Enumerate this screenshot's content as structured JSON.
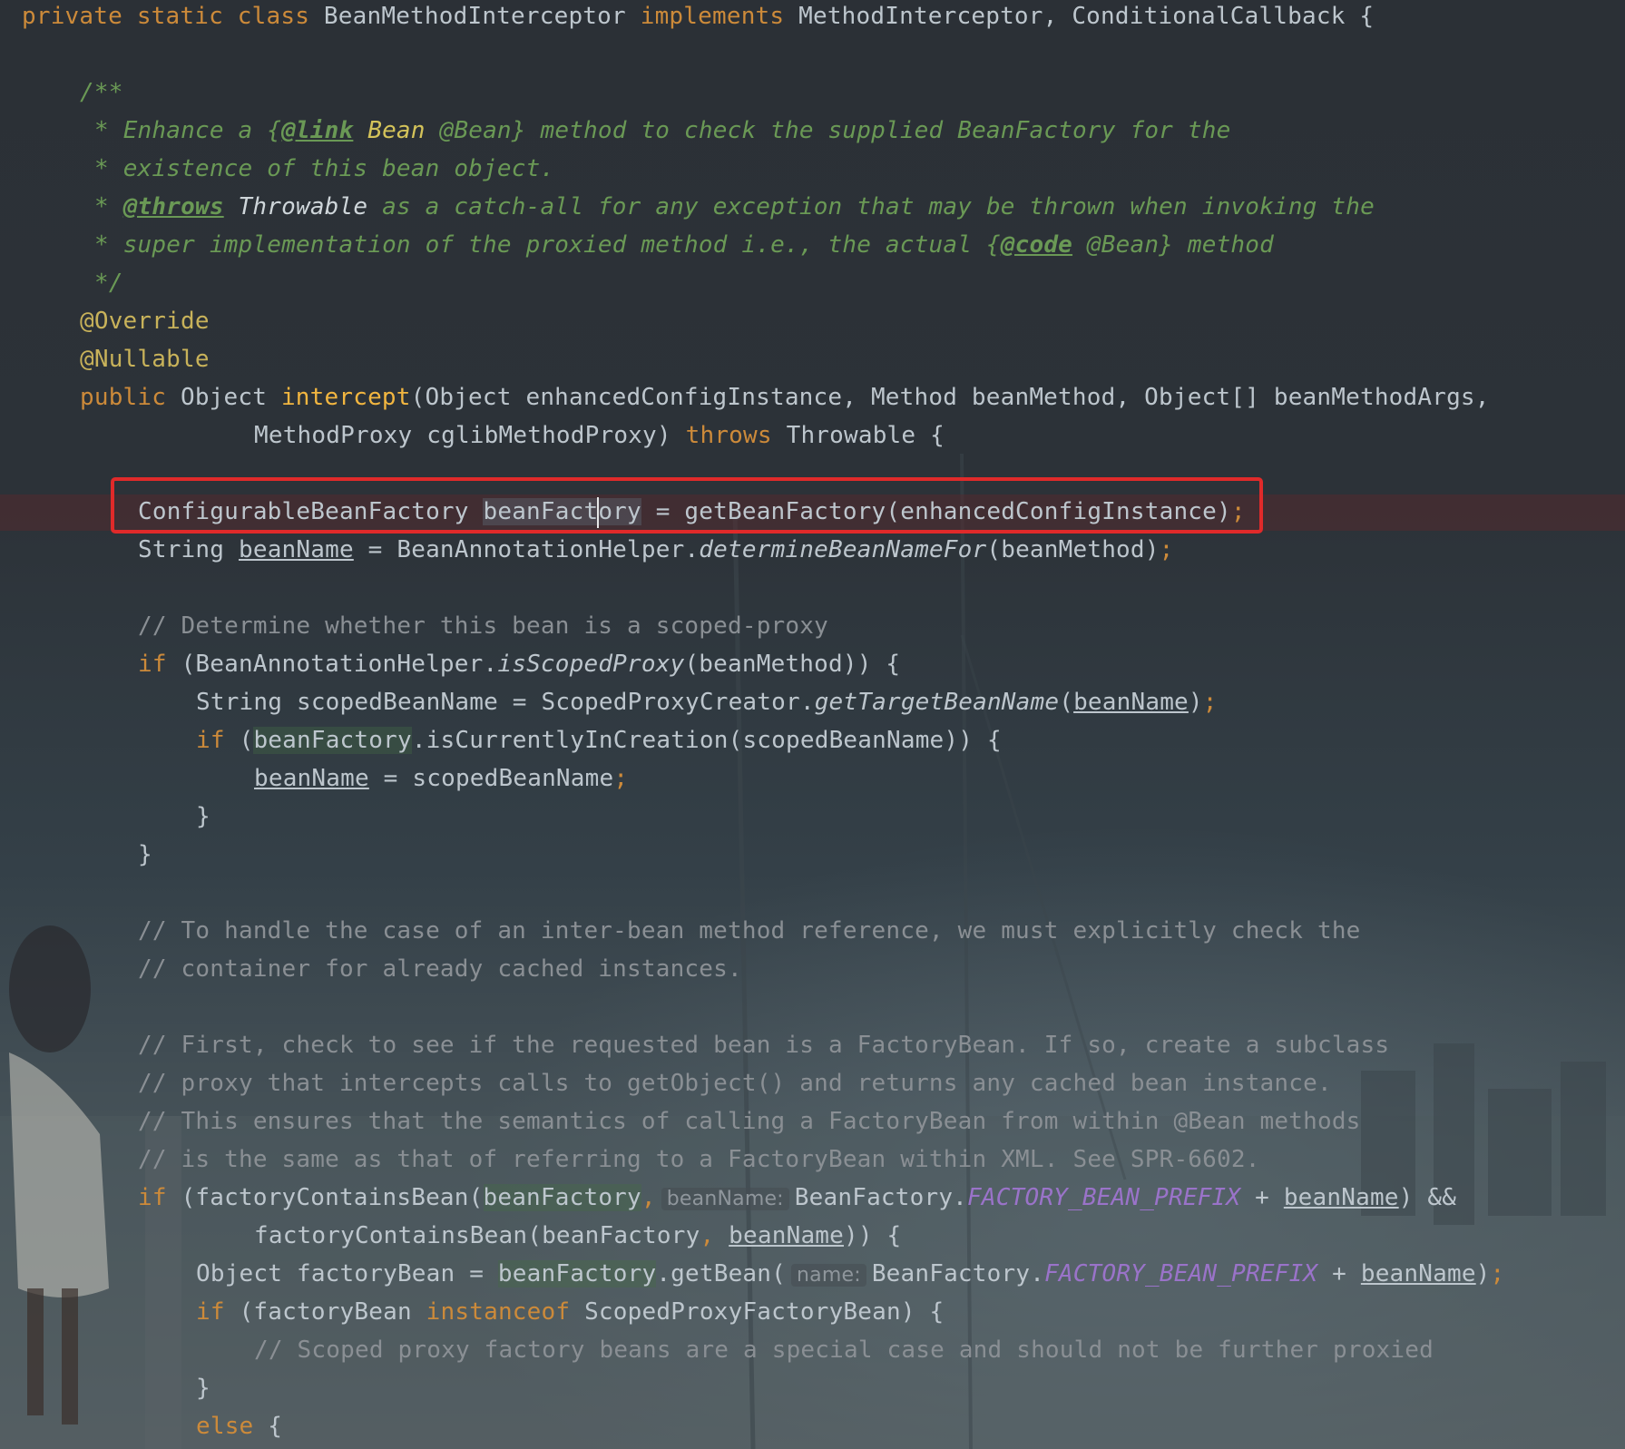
{
  "colors": {
    "keyword": "#cc8a3a",
    "annotation": "#c8b25a",
    "comment": "#8a8f94",
    "javadoc": "#6a9955",
    "constant": "#9a73c9",
    "highlight_box": "#e02a2a"
  },
  "code": {
    "l1": {
      "kw": "private static class",
      "name": " BeanMethodInterceptor ",
      "kw2": "implements",
      "rest": " MethodInterceptor, ConditionalCallback {"
    },
    "doc_open": "/**",
    "doc1": {
      "a": "* Enhance a {",
      "tag": "@link",
      "ref": " Bean",
      "b": " @Bean} method to check the supplied BeanFactory for the"
    },
    "doc2": "* existence of this bean object.",
    "doc3": {
      "a": "* ",
      "tag": "@throws",
      "plain": " Throwable",
      "b": " as a catch-all for any exception that may be thrown when invoking the"
    },
    "doc4": {
      "a": "* super implementation of the proxied method i.e., the actual {",
      "tag": "@code",
      "b": " @Bean} method"
    },
    "doc_close": "*/",
    "ann1": "@Override",
    "ann2": "@Nullable",
    "sig1": {
      "kw": "public",
      "type": " Object ",
      "method": "intercept",
      "params": "(Object enhancedConfigInstance, Method beanMethod, Object[] beanMethodArgs,"
    },
    "sig2": {
      "params": "MethodProxy cglibMethodProxy) ",
      "kw": "throws",
      "rest": " Throwable {"
    },
    "l_factory": {
      "type": "ConfigurableBeanFactory ",
      "var_a": "beanFact",
      "var_b": "ory",
      "rest": " = getBeanFactory(enhancedConfigInstance)",
      "semi": ";"
    },
    "l_beanname": {
      "type": "String ",
      "var": "beanName",
      "mid": " = BeanAnnotationHelper.",
      "call": "determineBeanNameFor",
      "rest": "(beanMethod)",
      "semi": ";"
    },
    "c_scoped": "// Determine whether this bean is a scoped-proxy",
    "if1": {
      "kw": "if",
      "a": " (BeanAnnotationHelper.",
      "call": "isScopedProxy",
      "b": "(beanMethod)) {"
    },
    "l_scoped": {
      "a": "String scopedBeanName = ScopedProxyCreator.",
      "call": "getTargetBeanName",
      "b": "(",
      "var": "beanName",
      "c": ")",
      "semi": ";"
    },
    "if2": {
      "kw": "if",
      "a": " (",
      "field": "beanFactory",
      "b": ".isCurrentlyInCreation(scopedBeanName)) {"
    },
    "l_assign": {
      "var": "beanName",
      "rest": " = scopedBeanName",
      "semi": ";"
    },
    "brace_close": "}",
    "c_handle1": "// To handle the case of an inter-bean method reference, we must explicitly check the",
    "c_handle2": "// container for already cached instances.",
    "c_first1": "// First, check to see if the requested bean is a FactoryBean. If so, create a subclass",
    "c_first2": "// proxy that intercepts calls to getObject() and returns any cached bean instance.",
    "c_first3": "// This ensures that the semantics of calling a FactoryBean from within @Bean methods",
    "c_first4": "// is the same as that of referring to a FactoryBean within XML. See SPR-6602.",
    "if3": {
      "kw": "if",
      "a": " (factoryContainsBean(",
      "field": "beanFactory",
      "comma": ",",
      "hint": "beanName:",
      "b": "BeanFactory.",
      "const": "FACTORY_BEAN_PREFIX",
      "c": " + ",
      "var": "beanName",
      "d": ") &&"
    },
    "if3b": {
      "a": "factoryContainsBean(beanFactory",
      "comma": ",",
      "sp": " ",
      "var": "beanName",
      "b": ")) {"
    },
    "l_fbean": {
      "a": "Object factoryBean = ",
      "field": "beanFactory",
      "b": ".getBean(",
      "hint": "name:",
      "c": "BeanFactory.",
      "const": "FACTORY_BEAN_PREFIX",
      "d": " + ",
      "var": "beanName",
      "e": ")",
      "semi": ";"
    },
    "if4": {
      "kw": "if",
      "a": " (factoryBean ",
      "kw2": "instanceof",
      "b": " ScopedProxyFactoryBean) {"
    },
    "c_scoped_proxy": "// Scoped proxy factory beans are a special case and should not be further proxied",
    "else": {
      "kw": "else",
      "rest": " {"
    }
  }
}
